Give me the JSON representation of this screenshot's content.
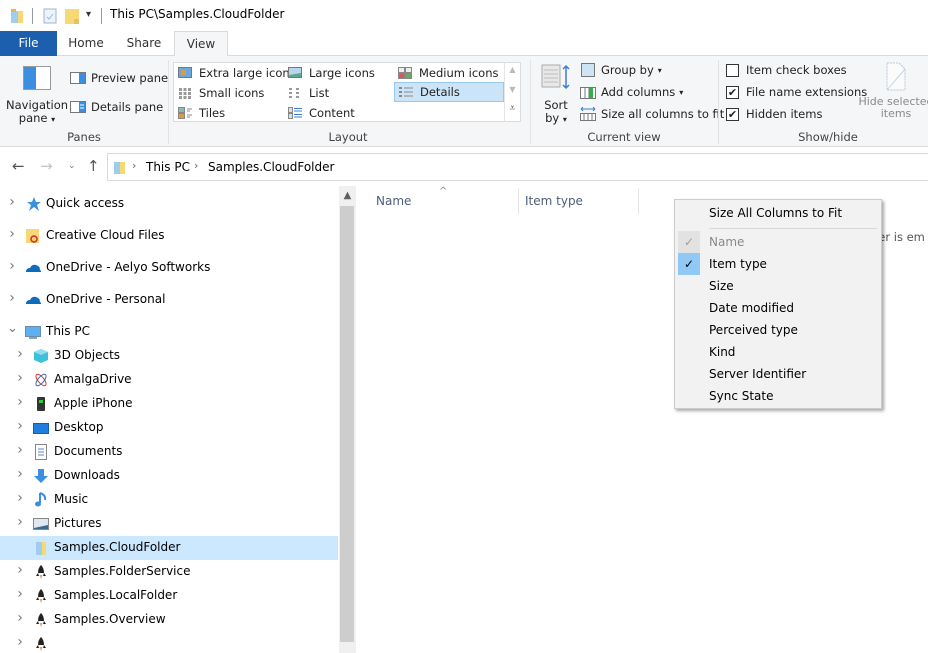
{
  "window": {
    "title": "This PC\\Samples.CloudFolder"
  },
  "tabs": [
    {
      "label": "File",
      "active": false
    },
    {
      "label": "Home",
      "active": false
    },
    {
      "label": "Share",
      "active": false
    },
    {
      "label": "View",
      "active": true
    }
  ],
  "ribbon": {
    "panes": {
      "label": "Panes",
      "navigation_pane_line1": "Navigation",
      "navigation_pane_line2": "pane",
      "preview_pane": "Preview pane",
      "details_pane": "Details pane"
    },
    "layout": {
      "label": "Layout",
      "options": [
        {
          "label": "Extra large icons",
          "selected": false
        },
        {
          "label": "Large icons",
          "selected": false
        },
        {
          "label": "Medium icons",
          "selected": false
        },
        {
          "label": "Small icons",
          "selected": false
        },
        {
          "label": "List",
          "selected": false
        },
        {
          "label": "Details",
          "selected": true
        },
        {
          "label": "Tiles",
          "selected": false
        },
        {
          "label": "Content",
          "selected": false
        }
      ]
    },
    "current_view": {
      "label": "Current view",
      "sort_by_line1": "Sort",
      "sort_by_line2": "by",
      "group_by": "Group by",
      "add_columns": "Add columns",
      "size_all_columns": "Size all columns to fit"
    },
    "show_hide": {
      "label": "Show/hide",
      "item_check_boxes": {
        "label": "Item check boxes",
        "checked": false
      },
      "file_name_extensions": {
        "label": "File name extensions",
        "checked": true
      },
      "hidden_items": {
        "label": "Hidden items",
        "checked": true
      },
      "hide_selected_line1": "Hide selected",
      "hide_selected_line2": "items"
    }
  },
  "address": {
    "crumbs": [
      "This PC",
      "Samples.CloudFolder"
    ]
  },
  "nav_tree": [
    {
      "label": "Quick access",
      "icon": "star-icon",
      "expander": "collapsed",
      "level": 0
    },
    {
      "label": "Creative Cloud Files",
      "icon": "creative-cloud-folder-icon",
      "expander": "collapsed",
      "level": 0
    },
    {
      "label": "OneDrive - Aelyo Softworks",
      "icon": "onedrive-cloud-icon",
      "expander": "collapsed",
      "level": 0
    },
    {
      "label": "OneDrive - Personal",
      "icon": "onedrive-cloud-icon",
      "expander": "collapsed",
      "level": 0
    },
    {
      "label": "This PC",
      "icon": "computer-icon",
      "expander": "expanded",
      "level": 0
    },
    {
      "label": "3D Objects",
      "icon": "cube-icon",
      "expander": "collapsed",
      "level": 1
    },
    {
      "label": "AmalgaDrive",
      "icon": "amalgadrive-icon",
      "expander": "collapsed",
      "level": 1
    },
    {
      "label": "Apple iPhone",
      "icon": "phone-icon",
      "expander": "collapsed",
      "level": 1
    },
    {
      "label": "Desktop",
      "icon": "desktop-icon",
      "expander": "collapsed",
      "level": 1
    },
    {
      "label": "Documents",
      "icon": "document-icon",
      "expander": "collapsed",
      "level": 1
    },
    {
      "label": "Downloads",
      "icon": "download-arrow-icon",
      "expander": "collapsed",
      "level": 1
    },
    {
      "label": "Music",
      "icon": "music-note-icon",
      "expander": "collapsed",
      "level": 1
    },
    {
      "label": "Pictures",
      "icon": "pictures-icon",
      "expander": "collapsed",
      "level": 1
    },
    {
      "label": "Samples.CloudFolder",
      "icon": "cloud-folder-icon",
      "expander": "none",
      "level": 1,
      "selected": true
    },
    {
      "label": "Samples.FolderService",
      "icon": "rocket-icon",
      "expander": "collapsed",
      "level": 1
    },
    {
      "label": "Samples.LocalFolder",
      "icon": "rocket-icon",
      "expander": "collapsed",
      "level": 1
    },
    {
      "label": "Samples.Overview",
      "icon": "rocket-icon",
      "expander": "collapsed",
      "level": 1
    }
  ],
  "content": {
    "columns": [
      "Name",
      "Item type"
    ],
    "sorted_column": "Name",
    "empty_message_fragment": "der is em"
  },
  "context_menu": {
    "items": [
      {
        "label": "Size All Columns to Fit",
        "check": "none",
        "enabled": true
      },
      {
        "label": "Name",
        "check": "checked",
        "enabled": false
      },
      {
        "label": "Item type",
        "check": "checked",
        "enabled": true
      },
      {
        "label": "Size",
        "check": "none",
        "enabled": true
      },
      {
        "label": "Date modified",
        "check": "none",
        "enabled": true
      },
      {
        "label": "Perceived type",
        "check": "none",
        "enabled": true
      },
      {
        "label": "Kind",
        "check": "none",
        "enabled": true
      },
      {
        "label": "Server Identifier",
        "check": "none",
        "enabled": true
      },
      {
        "label": "Sync State",
        "check": "none",
        "enabled": true
      }
    ]
  },
  "colors": {
    "file_tab": "#1c5fae",
    "selection": "#cce8ff",
    "menu_check_highlight": "#90c8f6",
    "column_header_text": "#4c607a"
  }
}
